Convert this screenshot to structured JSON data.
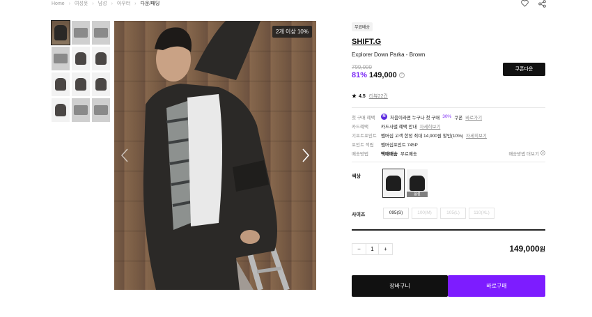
{
  "breadcrumb": [
    "Home",
    "여성옷",
    "남성",
    "아우터",
    "다운/패딩"
  ],
  "colors": {
    "accent": "#7d1cff",
    "discount": "#7d2cf5",
    "dark": "#111111"
  },
  "gallery": {
    "promo_badge": "2개 이상 10%"
  },
  "product": {
    "free_shipping": "무료배송",
    "brand": "SHIFT.G",
    "name": "Explorer Down Parka - Brown",
    "original_price": "799,000",
    "discount": "81%",
    "price": "149,000",
    "coupon_button": "쿠폰다운",
    "rating": "4.5",
    "review_link": "리뷰22건"
  },
  "benefits": {
    "first_purchase": {
      "label": "첫 구매 혜택",
      "badge": "M",
      "text_a": "처음이라면 누구나 첫 구매",
      "pct": "30%",
      "text_b": "쿠폰",
      "link": "바로가기"
    },
    "card": {
      "label": "카드혜택",
      "text": "카드사별 혜택 안내",
      "link": "자세히보기"
    },
    "gift_point": {
      "label": "기프트포인트",
      "text": "멤버십 고객 한정 최대 14,900원 할인(10%)",
      "link": "자세히보기"
    },
    "point": {
      "label": "포인트 적립",
      "text": "멤버십포인트 745P"
    },
    "shipping": {
      "label": "배송방법",
      "method": "택배배송",
      "fee": "무료배송",
      "more": "배송방법 더보기"
    }
  },
  "options": {
    "color_label": "색상",
    "soldout_label": "품절",
    "size_label": "사이즈",
    "sizes": [
      "095(S)",
      "100(M)",
      "105(L)",
      "110(XL)"
    ]
  },
  "purchase": {
    "qty": "1",
    "minus": "−",
    "plus": "+",
    "total": "149,000",
    "currency": "원",
    "cart_button": "장바구니",
    "buy_button": "바로구매"
  }
}
